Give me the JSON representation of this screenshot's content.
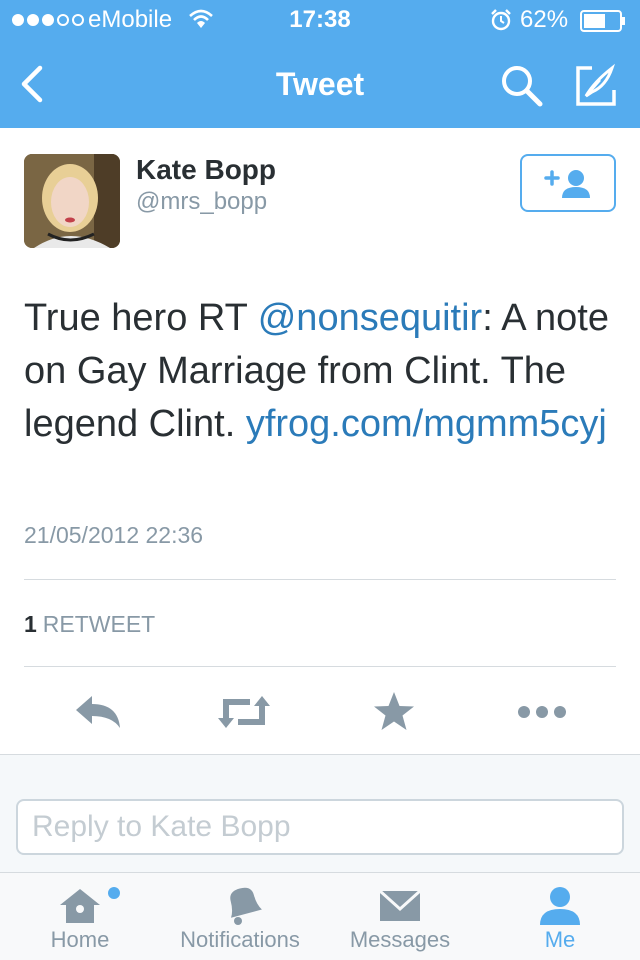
{
  "status_bar": {
    "carrier": "eMobile",
    "time": "17:38",
    "battery": "62%",
    "signal_bars_filled": 3,
    "signal_bars_total": 5,
    "battery_level": 0.62
  },
  "nav": {
    "title": "Tweet",
    "icons": [
      "back-icon",
      "search-icon",
      "compose-icon"
    ]
  },
  "tweet": {
    "author_name": "Kate Bopp",
    "author_handle": "@mrs_bopp",
    "text_before_mention": "True hero RT ",
    "mention": "@nonsequitir",
    "text_after_mention": ": A note on Gay Marriage from Clint. The legend Clint.  ",
    "link": "yfrog.com/​mgmm5cyj",
    "timestamp": "21/05/2012 22:36",
    "retweet_count": "1",
    "retweet_label": "RETWEET"
  },
  "actions": [
    "reply-icon",
    "retweet-icon",
    "favorite-icon",
    "more-icon"
  ],
  "reply": {
    "placeholder": "Reply to Kate Bopp"
  },
  "tabs": [
    {
      "label": "Home",
      "icon": "home-icon",
      "active": false,
      "unread": true
    },
    {
      "label": "Notifications",
      "icon": "bell-icon",
      "active": false,
      "unread": false
    },
    {
      "label": "Messages",
      "icon": "envelope-icon",
      "active": false,
      "unread": false
    },
    {
      "label": "Me",
      "icon": "person-icon",
      "active": true,
      "unread": false
    }
  ],
  "colors": {
    "brand": "#55acee",
    "link": "#2b7bb9",
    "text": "#292f33",
    "muted": "#8899a6"
  }
}
